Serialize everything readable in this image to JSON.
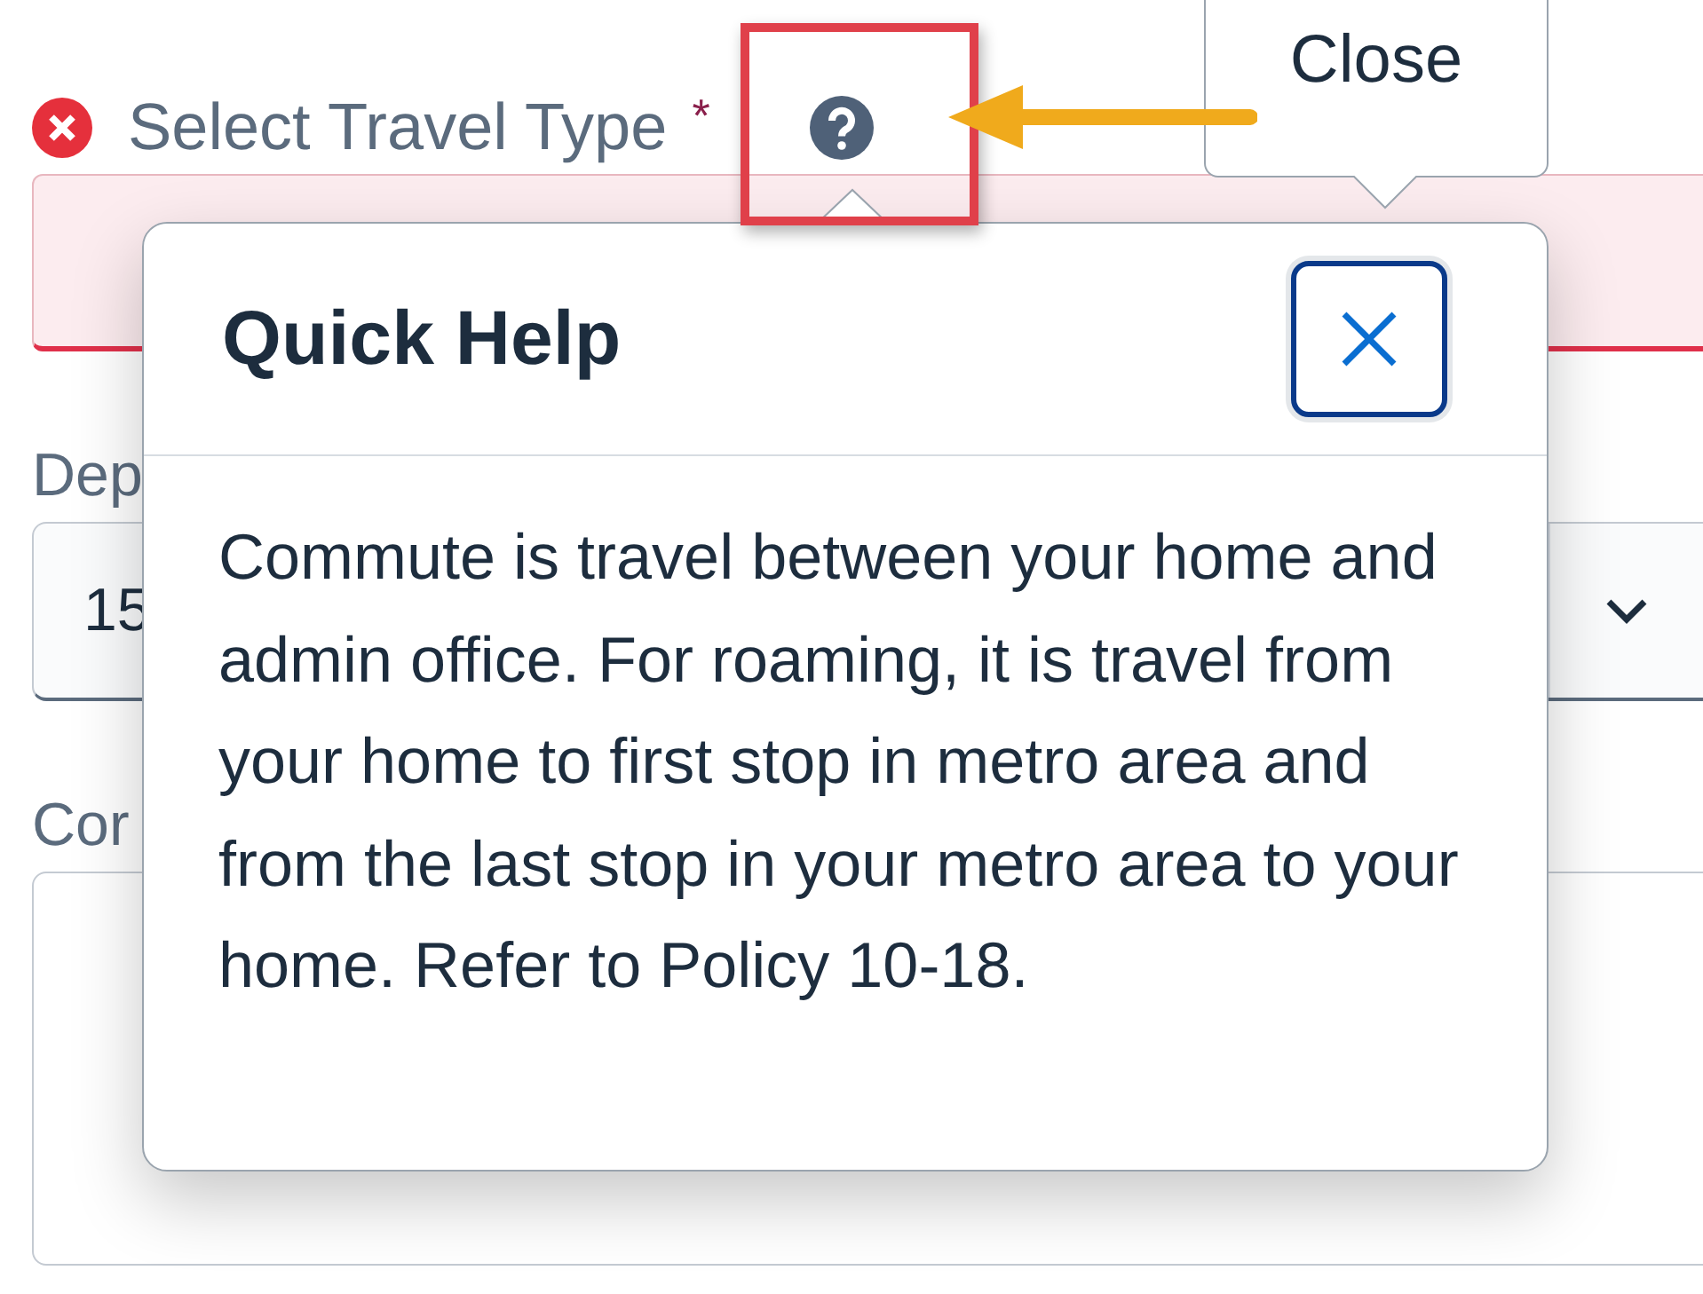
{
  "form": {
    "fields": [
      {
        "kind": "choice",
        "label": "Select Travel Type",
        "required_mark": "*",
        "error": true,
        "help": true
      },
      {
        "kind": "select",
        "label": "Dep",
        "value": "15"
      },
      {
        "kind": "textarea",
        "label": "Cor"
      }
    ]
  },
  "tooltip": {
    "text": "Close"
  },
  "popover": {
    "title": "Quick Help",
    "body": "Commute is travel between your home and admin office. For roaming, it is travel from your home to first stop in metro area and from the last stop in your metro area to your home. Refer to Policy 10-18."
  }
}
